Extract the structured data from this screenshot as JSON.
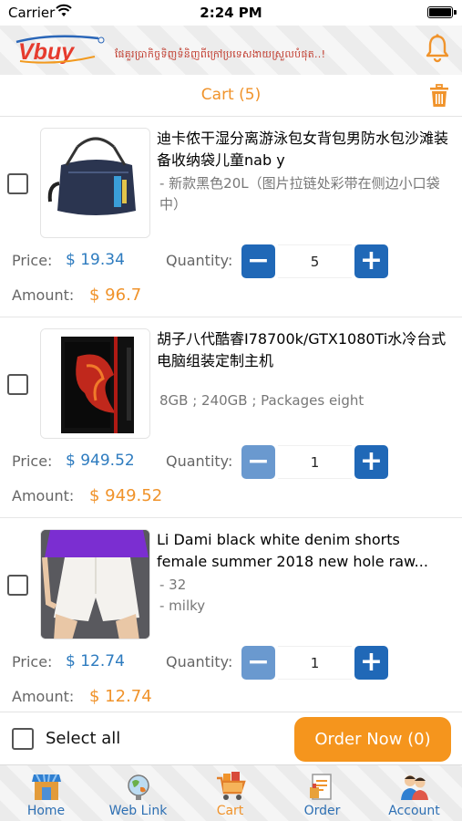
{
  "status_bar": {
    "carrier": "Carrier",
    "time": "2:24 PM"
  },
  "header": {
    "logo_text": "Vbuy",
    "tagline": "ផែគួរប្រាកិច្ចទិញទំនិញពីក្រៅប្រទេសងាយស្រួលបំផុត..!"
  },
  "titlebar": {
    "title": "Cart (5)"
  },
  "items": [
    {
      "name": "迪卡侬干湿分离游泳包女背包男防水包沙滩装备收纳袋儿童nab y",
      "specs": [
        "- 新款黑色20L（图片拉链处彩带在侧边小口袋中）"
      ],
      "price_label": "Price:",
      "price": "$ 19.34",
      "quantity_label": "Quantity:",
      "quantity": "5",
      "amount_label": "Amount:",
      "amount": "$ 96.7"
    },
    {
      "name": "胡子八代酷睿I78700k/GTX1080Ti水冷台式电脑组装定制主机",
      "specs": [
        "8GB ; 240GB ; Packages eight"
      ],
      "price_label": "Price:",
      "price": "$ 949.52",
      "quantity_label": "Quantity:",
      "quantity": "1",
      "amount_label": "Amount:",
      "amount": "$ 949.52"
    },
    {
      "name": "Li Dami black white denim shorts female summer 2018 new hole raw...",
      "specs": [
        "- 32",
        "- milky"
      ],
      "price_label": "Price:",
      "price": "$ 12.74",
      "quantity_label": "Quantity:",
      "quantity": "1",
      "amount_label": "Amount:",
      "amount": "$ 12.74"
    }
  ],
  "order_bar": {
    "select_all": "Select all",
    "order_button": "Order Now (0)"
  },
  "tabs": [
    {
      "label": "Home",
      "icon": "store-icon"
    },
    {
      "label": "Web Link",
      "icon": "globe-icon"
    },
    {
      "label": "Cart",
      "icon": "cart-icon",
      "active": true
    },
    {
      "label": "Order",
      "icon": "order-icon"
    },
    {
      "label": "Account",
      "icon": "account-icon"
    }
  ],
  "colors": {
    "accent": "#f0932b",
    "blue": "#2068b7",
    "price_blue": "#2d7bbf",
    "order_button": "#f5951d"
  }
}
